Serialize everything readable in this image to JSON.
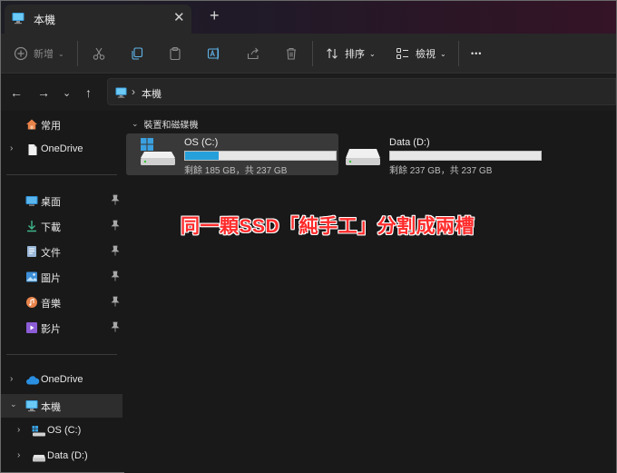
{
  "tab": {
    "title": "本機",
    "close": "✕",
    "new": "+"
  },
  "toolbar": {
    "new_label": "新增",
    "sort_label": "排序",
    "view_label": "檢視",
    "more": "•••"
  },
  "address": {
    "path": "本機"
  },
  "sidebar": {
    "quick_access": "常用",
    "onedrive_top": "OneDrive",
    "pinned": [
      {
        "label": "桌面",
        "icon": "desktop-icon"
      },
      {
        "label": "下載",
        "icon": "download-icon"
      },
      {
        "label": "文件",
        "icon": "documents-icon"
      },
      {
        "label": "圖片",
        "icon": "pictures-icon"
      },
      {
        "label": "音樂",
        "icon": "music-icon"
      },
      {
        "label": "影片",
        "icon": "videos-icon"
      }
    ],
    "onedrive": "OneDrive",
    "this_pc": "本機",
    "drive_c": "OS (C:)",
    "drive_d": "Data (D:)"
  },
  "main": {
    "group_title": "裝置和磁碟機",
    "drives": [
      {
        "name": "OS (C:)",
        "space": "剩餘 185 GB，共 237 GB",
        "used_fraction": 0.22
      },
      {
        "name": "Data (D:)",
        "space": "剩餘 237 GB，共 237 GB",
        "used_fraction": 0.0
      }
    ]
  },
  "overlay": {
    "caption": "同一顆SSD「純手工」分割成兩槽"
  },
  "colors": {
    "accent": "#26a0da",
    "overlay_text": "#ff2b2b"
  }
}
